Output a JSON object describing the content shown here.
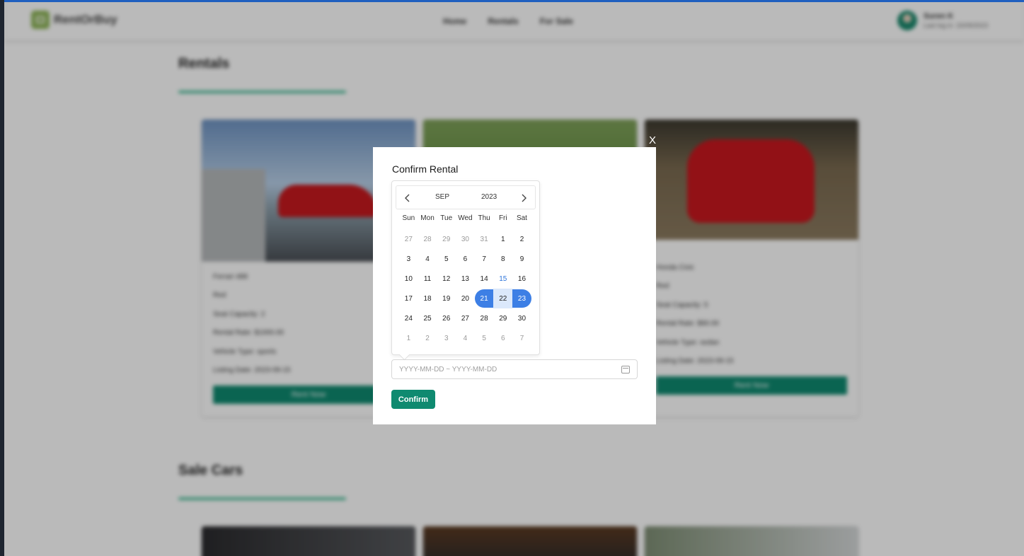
{
  "navbar": {
    "brand": "RentOrBuy",
    "links": [
      "Home",
      "Rentals",
      "For Sale"
    ],
    "user_name": "Suren K",
    "user_last_login": "Last log in: 15/09/2023"
  },
  "rentals": {
    "title": "Rentals",
    "cards": [
      {
        "name": "Ferrari 488",
        "color": "Red",
        "seat_capacity": "Seat Capacity: 2",
        "rental_rate": "Rental Rate: $1000.00",
        "vehicle_type": "Vehicle Type: sports",
        "listing_date": "Listing Date: 2023-09-15",
        "button": "Rent Now"
      },
      {
        "name": "Honda Civic",
        "color": "Red",
        "seat_capacity": "Seat Capacity: 5",
        "rental_rate": "Rental Rate: $90.00",
        "vehicle_type": "Vehicle Type: sedan",
        "listing_date": "Listing Date: 2023-09-15",
        "button": "Rent Now"
      }
    ]
  },
  "sale": {
    "title": "Sale Cars"
  },
  "modal": {
    "close_label": "X",
    "title": "Confirm Rental",
    "calendar": {
      "month": "SEP",
      "year": "2023",
      "prev_icon": "chevron-left-icon",
      "next_icon": "chevron-right-icon",
      "weekdays": [
        "Sun",
        "Mon",
        "Tue",
        "Wed",
        "Thu",
        "Fri",
        "Sat"
      ],
      "days": [
        "27",
        "28",
        "29",
        "30",
        "31",
        "1",
        "2",
        "3",
        "4",
        "5",
        "6",
        "7",
        "8",
        "9",
        "10",
        "11",
        "12",
        "13",
        "14",
        "15",
        "16",
        "17",
        "18",
        "19",
        "20",
        "21",
        "22",
        "23",
        "24",
        "25",
        "26",
        "27",
        "28",
        "29",
        "30",
        "1",
        "2",
        "3",
        "4",
        "5",
        "6",
        "7"
      ],
      "today": "15",
      "range_start": "21",
      "range_end": "23"
    },
    "date_input_placeholder": "YYYY-MM-DD ~ YYYY-MM-DD",
    "confirm_label": "Confirm"
  },
  "colors": {
    "accent": "#0f8a70",
    "range": "#3d7fe5",
    "today": "#2d74da"
  }
}
